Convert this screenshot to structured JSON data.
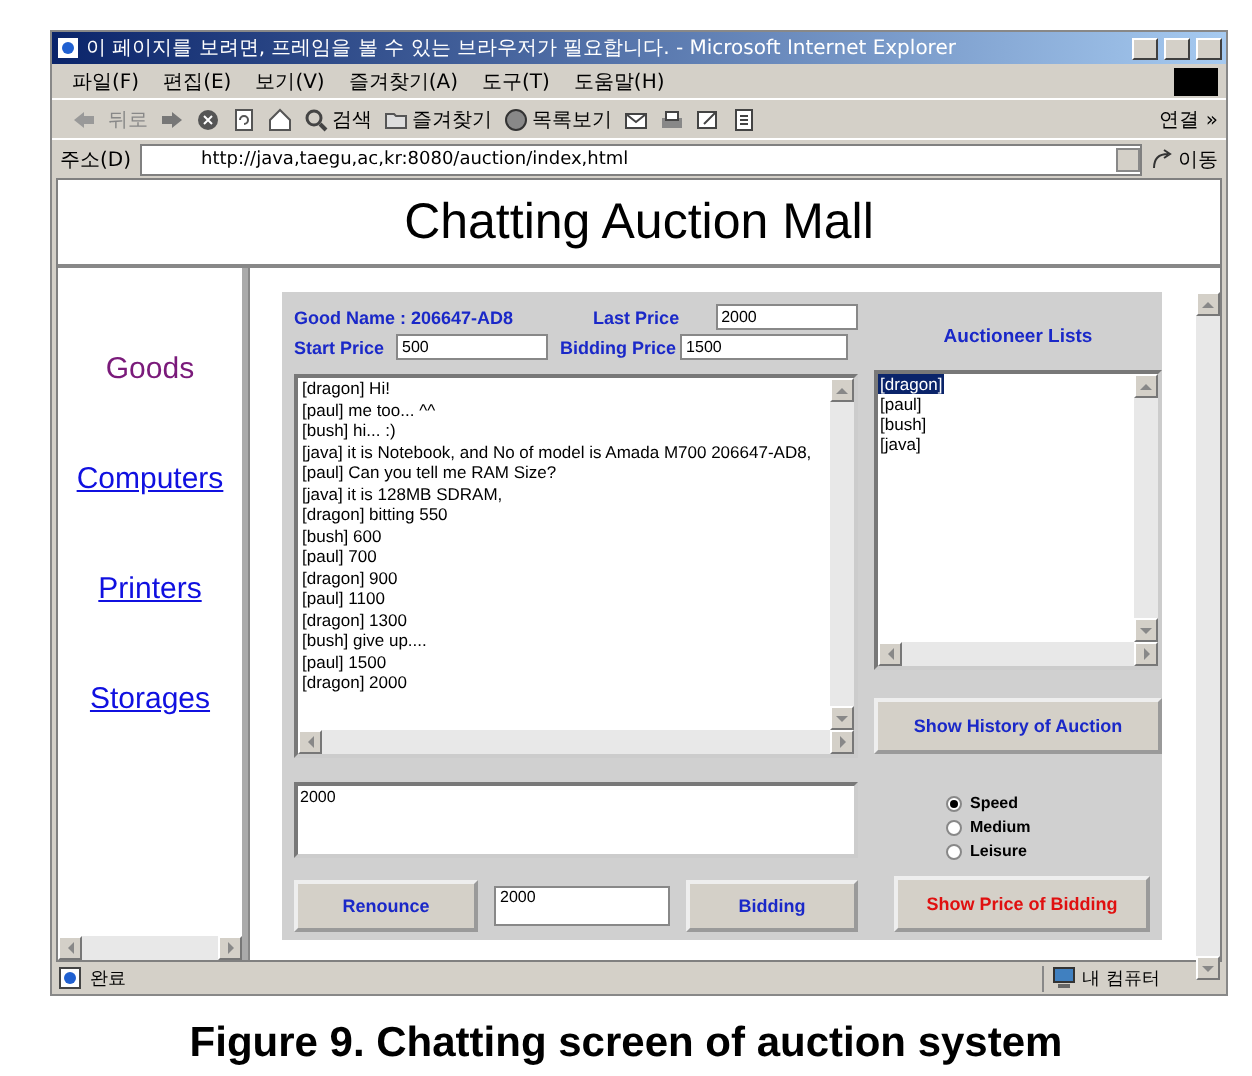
{
  "window": {
    "title": "이 페이지를 보려면, 프레임을 볼 수 있는 브라우저가 필요합니다. - Microsoft Internet Explorer"
  },
  "menu": [
    "파일(F)",
    "편집(E)",
    "보기(V)",
    "즐겨찾기(A)",
    "도구(T)",
    "도움말(H)"
  ],
  "toolbar": {
    "back": "뒤로",
    "search": "검색",
    "favorites": "즐겨찾기",
    "history": "목록보기",
    "links": "연결 »"
  },
  "address": {
    "label": "주소(D)",
    "url": "http://java,taegu,ac,kr:8080/auction/index,html",
    "go": "이동"
  },
  "header": {
    "title": "Chatting Auction Mall"
  },
  "sidebar": {
    "items": [
      {
        "label": "Goods",
        "visited": true
      },
      {
        "label": "Computers",
        "visited": false
      },
      {
        "label": "Printers",
        "visited": false
      },
      {
        "label": "Storages",
        "visited": false
      }
    ]
  },
  "auction": {
    "good_name": "Good Name : 206647-AD8",
    "last_price_label": "Last Price",
    "last_price": "2000",
    "start_price_label": "Start Price",
    "start_price": "500",
    "bidding_price_label": "Bidding Price",
    "bidding_price": "1500",
    "chat": [
      "[dragon] Hi!",
      "[paul] me too... ^^",
      "[bush] hi... :)",
      "[java] it is Notebook, and No of model is Amada M700 206647-AD8,",
      "[paul] Can you tell me RAM Size?",
      "[java] it is 128MB SDRAM,",
      "[dragon] bitting 550",
      "[bush] 600",
      "[paul] 700",
      "[dragon] 900",
      "[paul] 1100",
      "[dragon] 1300",
      "[bush] give up....",
      "[paul] 1500",
      "[dragon] 2000"
    ],
    "message": "2000",
    "auctioneers_title": "Auctioneer Lists",
    "auctioneers": [
      {
        "name": "[dragon]",
        "selected": true
      },
      {
        "name": "[paul]",
        "selected": false
      },
      {
        "name": "[bush]",
        "selected": false
      },
      {
        "name": "[java]",
        "selected": false
      }
    ],
    "history_button": "Show History of Auction",
    "speeds": [
      {
        "label": "Speed",
        "selected": true
      },
      {
        "label": "Medium",
        "selected": false
      },
      {
        "label": "Leisure",
        "selected": false
      }
    ],
    "renounce_button": "Renounce",
    "bid_value": "2000",
    "bidding_button": "Bidding",
    "show_price_button": "Show Price of Bidding"
  },
  "status_bar": {
    "text": "완료",
    "zone": "내 컴퓨터"
  },
  "caption": "Figure 9. Chatting screen of auction system"
}
